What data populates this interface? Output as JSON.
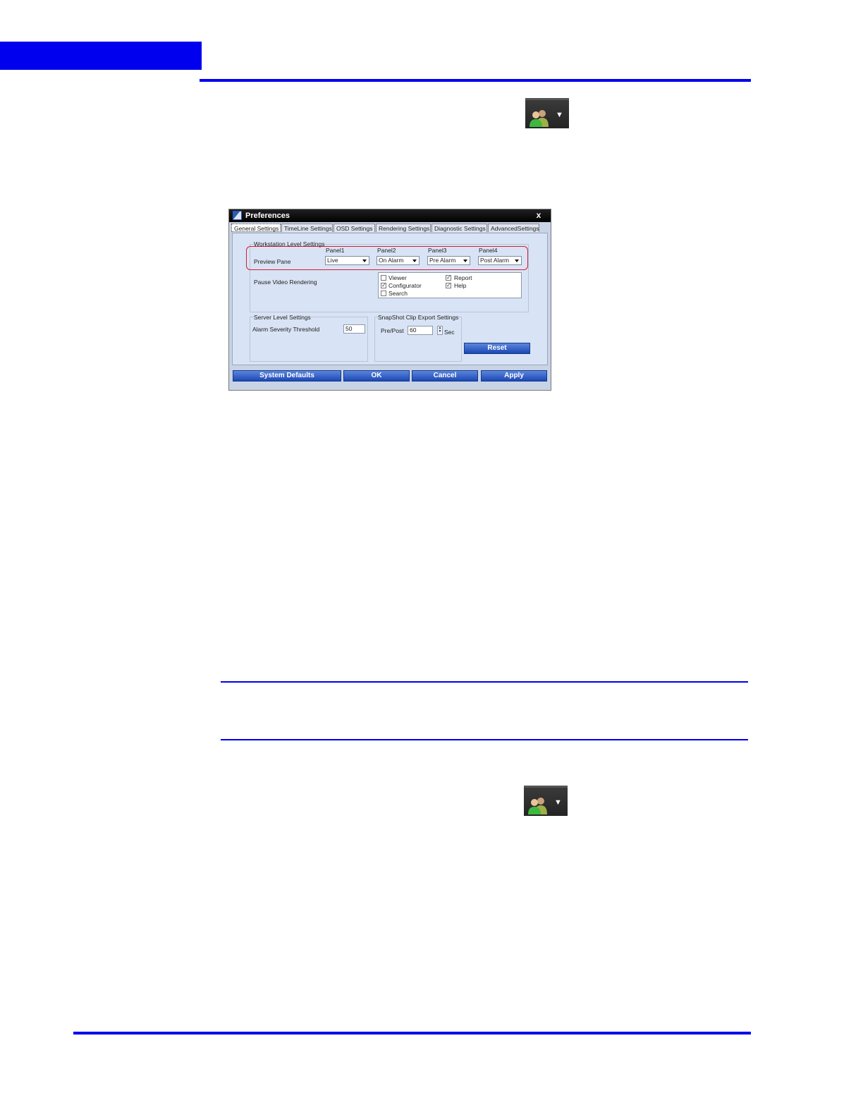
{
  "colors": {
    "accent_blue": "#0000ee",
    "title_bar": "#000000",
    "button_blue": "#1d48b6",
    "highlight_red": "#d02030"
  },
  "icons": {
    "user_menu": "users-icon",
    "dropdown": "triangle-down-icon"
  },
  "dialog": {
    "title": "Preferences",
    "close_label": "x",
    "tabs": [
      "General Settings",
      "TimeLine Settings",
      "OSD Settings",
      "Rendering Settings",
      "Diagnostic Settings",
      "AdvancedSettings"
    ],
    "workstation": {
      "group_label": "Workstation Level Settings",
      "panel_headers": [
        "Panel1",
        "Panel2",
        "Panel3",
        "Panel4"
      ],
      "preview_label": "Preview Pane",
      "preview_values": [
        "Live",
        "On Alarm",
        "Pre Alarm",
        "Post Alarm"
      ],
      "pause_label": "Pause Video Rendering",
      "pause_options": [
        {
          "label": "Viewer",
          "checked": false
        },
        {
          "label": "Report",
          "checked": true
        },
        {
          "label": "Configurator",
          "checked": true
        },
        {
          "label": "Help",
          "checked": true
        },
        {
          "label": "Search",
          "checked": false
        }
      ]
    },
    "server": {
      "group_label": "Server Level Settings",
      "alarm_label": "Alarm Severity Threshold",
      "alarm_value": "50"
    },
    "snapshot": {
      "group_label": "SnapShot Clip Export Settings",
      "prepost_label": "Pre/Post",
      "prepost_value": "60",
      "unit": "Sec"
    },
    "reset_label": "Reset",
    "buttons": [
      "System Defaults",
      "OK",
      "Cancel",
      "Apply"
    ]
  }
}
